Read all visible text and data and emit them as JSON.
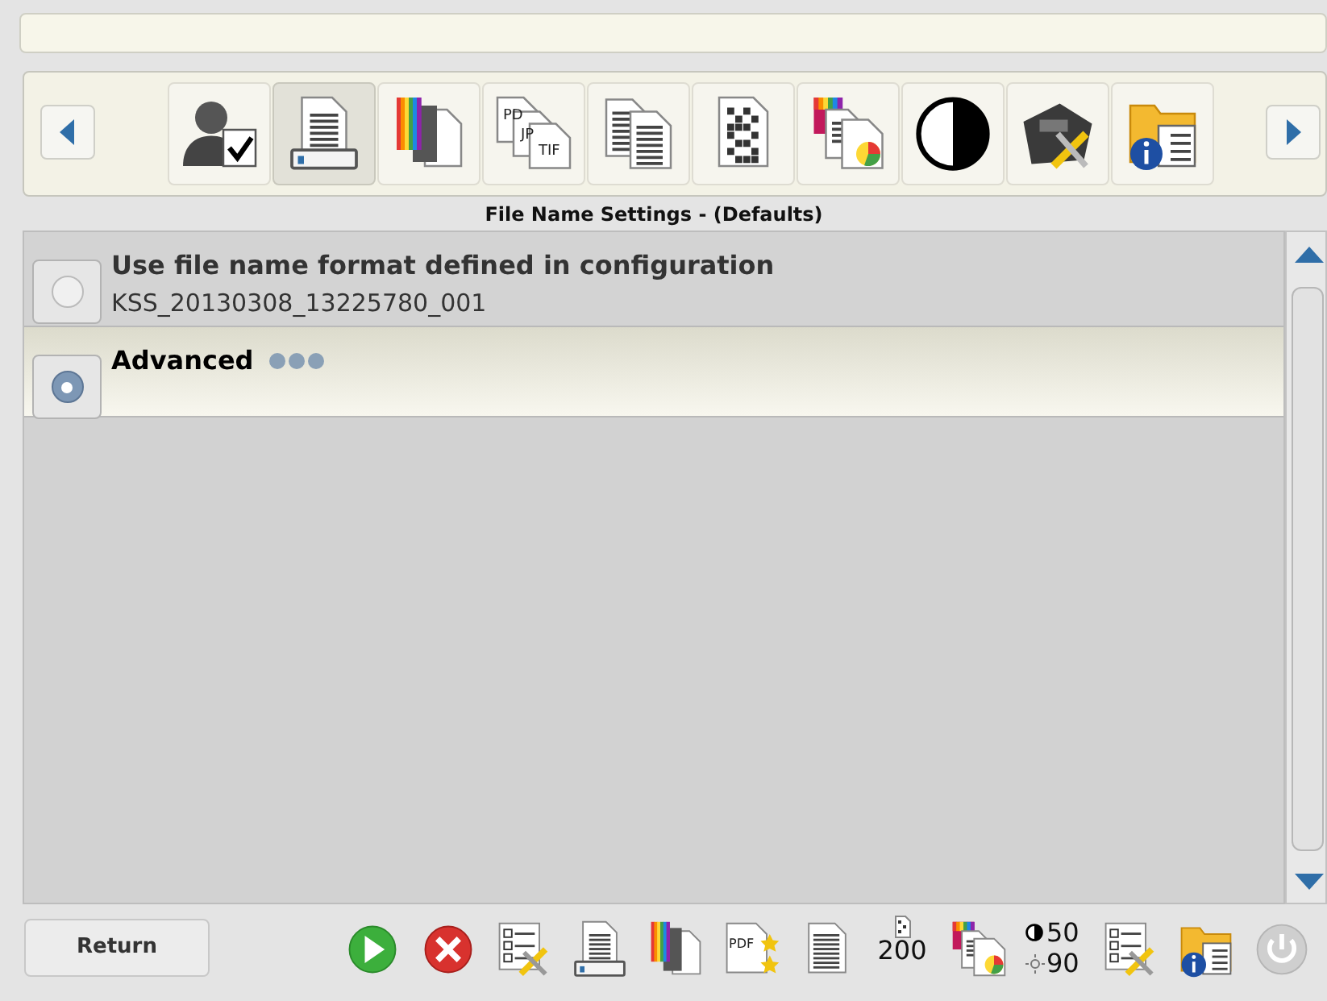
{
  "toolbar": {
    "items": [
      {
        "kind": "user",
        "selected": false
      },
      {
        "kind": "scanner",
        "selected": true
      },
      {
        "kind": "color",
        "selected": false
      },
      {
        "kind": "formats",
        "selected": false,
        "labels": [
          "PD",
          "JP",
          "TIF"
        ]
      },
      {
        "kind": "pages",
        "selected": false
      },
      {
        "kind": "dots",
        "selected": false
      },
      {
        "kind": "color-doc",
        "selected": false
      },
      {
        "kind": "contrast",
        "selected": false
      },
      {
        "kind": "device-tools",
        "selected": false
      },
      {
        "kind": "folder-info",
        "selected": false
      }
    ]
  },
  "section_title": "File Name Settings - (Defaults)",
  "options": [
    {
      "title": "Use file name format defined in configuration",
      "subtitle": "KSS_20130308_13225780_001",
      "selected": false,
      "has_more": false
    },
    {
      "title": "Advanced",
      "selected": true,
      "has_more": true
    }
  ],
  "footer": {
    "return_button": "Return",
    "icons": [
      {
        "kind": "start"
      },
      {
        "kind": "cancel"
      },
      {
        "kind": "checklist-tools"
      },
      {
        "kind": "scanner"
      },
      {
        "kind": "color"
      },
      {
        "kind": "pdf-stars",
        "labels": [
          "PDF"
        ]
      },
      {
        "kind": "document"
      },
      {
        "kind": "resolution",
        "labels": [
          "200"
        ]
      },
      {
        "kind": "color-doc"
      },
      {
        "kind": "contrast-brightness",
        "labels": [
          "50",
          "90"
        ]
      },
      {
        "kind": "checklist-tools"
      },
      {
        "kind": "folder-info"
      },
      {
        "kind": "power"
      }
    ]
  }
}
